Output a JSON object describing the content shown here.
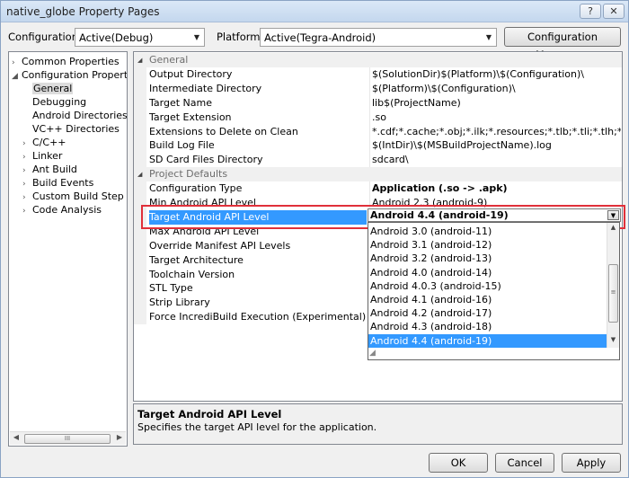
{
  "window": {
    "title": "native_globe Property Pages",
    "help_glyph": "?",
    "close_glyph": "✕"
  },
  "config_bar": {
    "configuration_label": "Configuration:",
    "configuration_value": "Active(Debug)",
    "platform_label": "Platform:",
    "platform_value": "Active(Tegra-Android)",
    "manager_button": "Configuration Manager..."
  },
  "tree": [
    {
      "label": "Common Properties",
      "expander": "›",
      "indent": 0
    },
    {
      "label": "Configuration Properties",
      "expander": "◢",
      "indent": 0
    },
    {
      "label": "General",
      "expander": "",
      "indent": 1,
      "selected": true
    },
    {
      "label": "Debugging",
      "expander": "",
      "indent": 1
    },
    {
      "label": "Android Directories",
      "expander": "",
      "indent": 1
    },
    {
      "label": "VC++ Directories",
      "expander": "",
      "indent": 1
    },
    {
      "label": "C/C++",
      "expander": "›",
      "indent": 1
    },
    {
      "label": "Linker",
      "expander": "›",
      "indent": 1
    },
    {
      "label": "Ant Build",
      "expander": "›",
      "indent": 1
    },
    {
      "label": "Build Events",
      "expander": "›",
      "indent": 1
    },
    {
      "label": "Custom Build Step",
      "expander": "›",
      "indent": 1
    },
    {
      "label": "Code Analysis",
      "expander": "›",
      "indent": 1
    }
  ],
  "tree_scroll": {
    "left_arrow": "◀",
    "right_arrow": "▶",
    "thumb_grip": "III"
  },
  "grid": {
    "rows": [
      {
        "type": "category",
        "name": "General",
        "expander": "◢"
      },
      {
        "name": "Output Directory",
        "value": "$(SolutionDir)$(Platform)\\$(Configuration)\\"
      },
      {
        "name": "Intermediate Directory",
        "value": "$(Platform)\\$(Configuration)\\"
      },
      {
        "name": "Target Name",
        "value": "lib$(ProjectName)"
      },
      {
        "name": "Target Extension",
        "value": ".so"
      },
      {
        "name": "Extensions to Delete on Clean",
        "value": "*.cdf;*.cache;*.obj;*.ilk;*.resources;*.tlb;*.tli;*.tlh;*.tmp;*.rsp;*.pgc"
      },
      {
        "name": "Build Log File",
        "value": "$(IntDir)\\$(MSBuildProjectName).log"
      },
      {
        "name": "SD Card Files Directory",
        "value": "sdcard\\"
      },
      {
        "type": "category",
        "name": "Project Defaults",
        "expander": "◢"
      },
      {
        "name": "Configuration Type",
        "value": "Application (.so -> .apk)",
        "bold": true
      },
      {
        "name": "Min Android API Level",
        "value": "Android 2.3 (android-9)"
      },
      {
        "name": "Target Android API Level",
        "value": "",
        "selected": true
      },
      {
        "name": "Max Android API Level",
        "value": ""
      },
      {
        "name": "Override Manifest API Levels",
        "value": ""
      },
      {
        "name": "Target Architecture",
        "value": ""
      },
      {
        "name": "Toolchain Version",
        "value": ""
      },
      {
        "name": "STL Type",
        "value": ""
      },
      {
        "name": "Strip Library",
        "value": ""
      },
      {
        "name": "Force IncrediBuild Execution (Experimental)",
        "value": ""
      }
    ]
  },
  "dropdown": {
    "selected_value": "Android 4.4 (android-19)",
    "arrow": "▼",
    "options": [
      "Android 3.0 (android-11)",
      "Android 3.1 (android-12)",
      "Android 3.2 (android-13)",
      "Android 4.0 (android-14)",
      "Android 4.0.3 (android-15)",
      "Android 4.1 (android-16)",
      "Android 4.2 (android-17)",
      "Android 4.3 (android-18)",
      "Android 4.4 (android-19)"
    ],
    "highlighted_index": 8,
    "scroll": {
      "up": "▲",
      "down": "▼",
      "grip": "≡"
    },
    "resize_grip": "◢"
  },
  "description": {
    "title": "Target Android API Level",
    "text": "Specifies the target API level for the application."
  },
  "buttons": {
    "ok": "OK",
    "cancel": "Cancel",
    "apply": "Apply"
  },
  "colors": {
    "selection": "#3399ff",
    "highlight_box": "#e0303a"
  }
}
